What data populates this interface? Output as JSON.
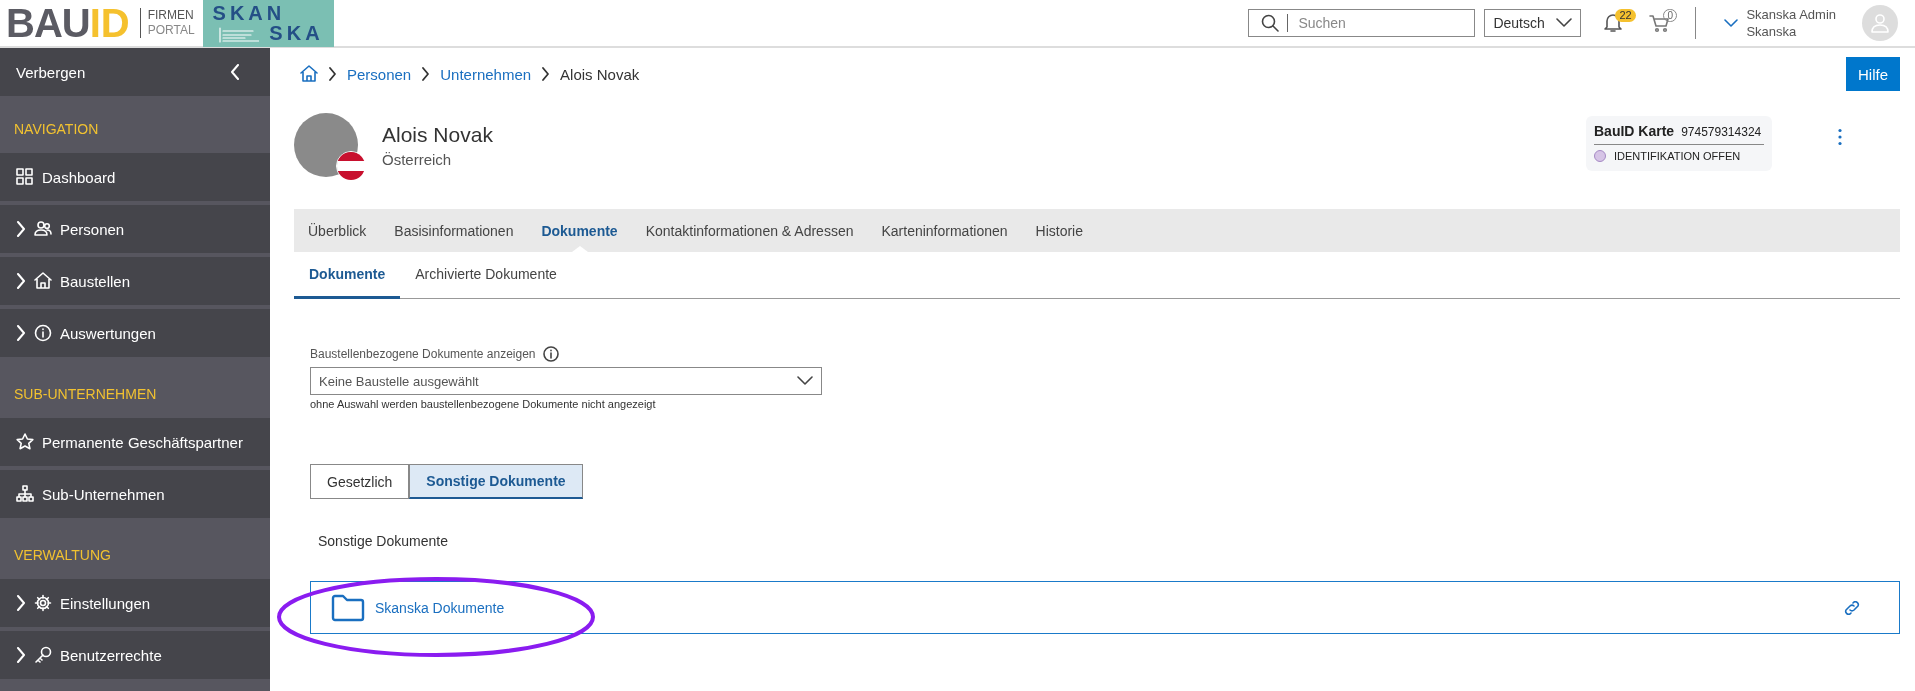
{
  "header": {
    "logo": {
      "primary": "BAU",
      "accent": "ID",
      "line1": "FIRMEN",
      "line2": "PORTAL"
    },
    "client_logo": {
      "line1": "SKAN",
      "line2": "SKA"
    },
    "search": {
      "placeholder": "Suchen"
    },
    "language": "Deutsch",
    "notifications": "22",
    "cart": "0",
    "user": {
      "name": "Skanska Admin",
      "company": "Skanska"
    }
  },
  "sidebar": {
    "toggle": "Verbergen",
    "sections": [
      {
        "title": "NAVIGATION",
        "items": [
          {
            "label": "Dashboard",
            "expandable": false
          },
          {
            "label": "Personen",
            "expandable": true
          },
          {
            "label": "Baustellen",
            "expandable": true
          },
          {
            "label": "Auswertungen",
            "expandable": true
          }
        ]
      },
      {
        "title": "SUB-UNTERNEHMEN",
        "items": [
          {
            "label": "Permanente Geschäftspartner",
            "expandable": false
          },
          {
            "label": "Sub-Unternehmen",
            "expandable": false
          }
        ]
      },
      {
        "title": "VERWALTUNG",
        "items": [
          {
            "label": "Einstellungen",
            "expandable": true
          },
          {
            "label": "Benutzerrechte",
            "expandable": true
          }
        ]
      }
    ]
  },
  "breadcrumb": [
    {
      "label": "Personen",
      "link": true
    },
    {
      "label": "Unternehmen",
      "link": true
    },
    {
      "label": "Alois Novak",
      "link": false
    }
  ],
  "help_button": "Hilfe",
  "profile": {
    "name": "Alois Novak",
    "country": "Österreich"
  },
  "card": {
    "title": "BauID Karte",
    "number": "974579314324",
    "status": "IDENTIFIKATION OFFEN"
  },
  "tabs": [
    {
      "label": "Überblick",
      "selected": false
    },
    {
      "label": "Basisinformationen",
      "selected": false
    },
    {
      "label": "Dokumente",
      "selected": true
    },
    {
      "label": "Kontaktinformationen & Adressen",
      "selected": false
    },
    {
      "label": "Karteninformationen",
      "selected": false
    },
    {
      "label": "Historie",
      "selected": false
    }
  ],
  "subtabs": [
    {
      "label": "Dokumente",
      "selected": true
    },
    {
      "label": "Archivierte Dokumente",
      "selected": false
    }
  ],
  "filter": {
    "label": "Baustellenbezogene Dokumente anzeigen",
    "value": "Keine Baustelle ausgewählt",
    "hint": "ohne Auswahl werden baustellenbezogene Dokumente nicht angezeigt"
  },
  "segments": [
    {
      "label": "Gesetzlich",
      "selected": false
    },
    {
      "label": "Sonstige Dokumente",
      "selected": true
    }
  ],
  "section_title": "Sonstige Dokumente",
  "folders": [
    {
      "label": "Skanska Dokumente"
    }
  ]
}
